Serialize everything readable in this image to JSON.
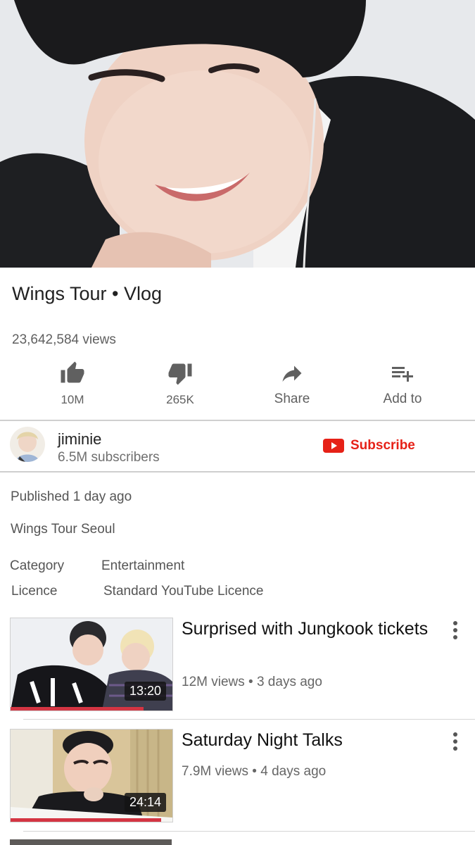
{
  "video": {
    "title": "Wings Tour • Vlog",
    "views": "23,642,584 views"
  },
  "actions": {
    "like_count": "10M",
    "dislike_count": "265K",
    "share_label": "Share",
    "add_to_label": "Add to"
  },
  "channel": {
    "name": "jiminie",
    "subscribers": "6.5M subscribers",
    "subscribe_label": "Subscribe"
  },
  "details": {
    "published": "Published 1 day ago",
    "description": "Wings Tour Seoul",
    "category_label": "Category",
    "category_value": "Entertainment",
    "licence_label": "Licence",
    "licence_value": "Standard YouTube Licence"
  },
  "related": [
    {
      "title": "Surprised with Jungkook tickets",
      "duration": "13:20",
      "meta": "12M views • 3 days ago",
      "watched_fraction": 0.82
    },
    {
      "title": "Saturday Night Talks",
      "duration": "24:14",
      "meta": "7.9M views • 4 days ago",
      "watched_fraction": 0.93
    }
  ],
  "colors": {
    "brand_red": "#e62117",
    "progress_red": "#d43543",
    "text_secondary": "#606060"
  }
}
